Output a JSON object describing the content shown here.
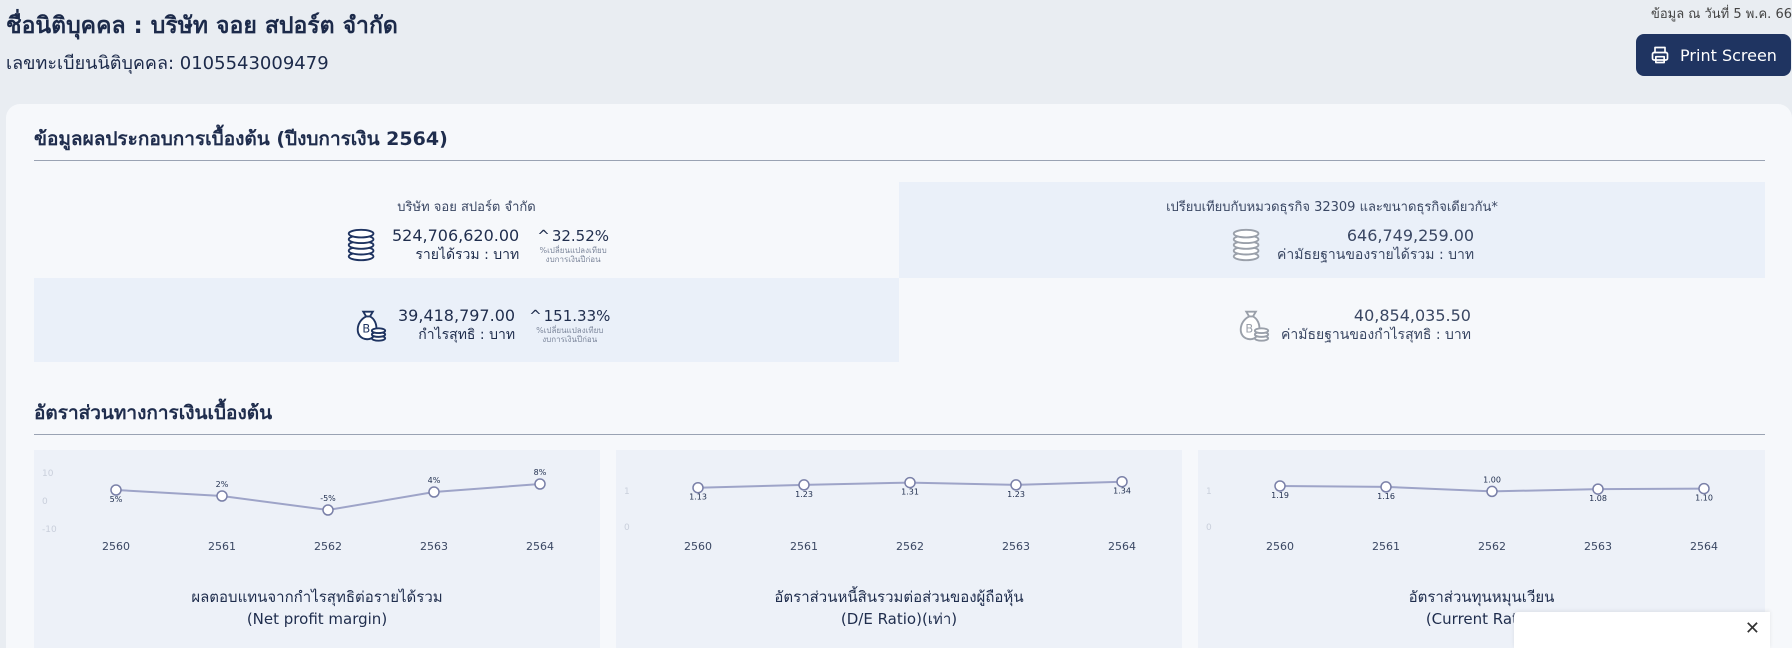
{
  "header": {
    "company_name": "ชื่อนิติบุคคล : บริษัท จอย สปอร์ต จำกัด",
    "registration": "เลขทะเบียนนิติบุคคล: 0105543009479",
    "as_of": "ข้อมูล ณ วันที่ 5 พ.ค. 66",
    "print_label": "Print Screen"
  },
  "performance": {
    "title": "ข้อมูลผลประกอบการเบื้องต้น (ปีงบการเงิน 2564)",
    "company_caption": "บริษัท จอย สปอร์ต จำกัด",
    "compare_caption": "เปรียบเทียบกับหมวดธุรกิจ 32309 และขนาดธุรกิจเดียวกัน*",
    "revenue": {
      "value": "524,706,620.00",
      "unit": "รายได้รวม : บาท",
      "change": "32.52%",
      "note_line1": "%เปลี่ยนแปลงเทียบ",
      "note_line2": "งบการเงินปีก่อน"
    },
    "net_profit": {
      "value": "39,418,797.00",
      "unit": "กำไรสุทธิ : บาท",
      "change": "151.33%",
      "note_line1": "%เปลี่ยนแปลงเทียบ",
      "note_line2": "งบการเงินปีก่อน"
    },
    "median_revenue": {
      "value": "646,749,259.00",
      "unit": "ค่ามัธยฐานของรายได้รวม : บาท"
    },
    "median_profit": {
      "value": "40,854,035.50",
      "unit": "ค่ามัธยฐานของกำไรสุทธิ : บาท"
    }
  },
  "ratios": {
    "title": "อัตราส่วนทางการเงินเบื้องต้น",
    "charts": [
      {
        "title1": "ผลตอบแทนจากกำไรสุทธิต่อรายได้รวม",
        "title2": "(Net profit margin)"
      },
      {
        "title1": "อัตราส่วนหนี้สินรวมต่อส่วนของผู้ถือหุ้น",
        "title2": "(D/E Ratio)(เท่า)"
      },
      {
        "title1": "อัตราส่วนทุนหมุนเวียน",
        "title2": "(Current Ratio)"
      }
    ]
  },
  "chart_data": [
    {
      "type": "line",
      "title": "ผลตอบแทนจากกำไรสุทธิต่อรายได้รวม (Net profit margin)",
      "x": [
        "2560",
        "2561",
        "2562",
        "2563",
        "2564"
      ],
      "values": [
        5,
        2,
        -5,
        4,
        8
      ],
      "data_labels": [
        "5%",
        "2%",
        "-5%",
        "4%",
        "8%"
      ],
      "y_ticks": [
        "10",
        "0",
        "-10"
      ],
      "ylim": [
        -10,
        10
      ]
    },
    {
      "type": "line",
      "title": "อัตราส่วนหนี้สินรวมต่อส่วนของผู้ถือหุ้น (D/E Ratio)(เท่า)",
      "x": [
        "2560",
        "2561",
        "2562",
        "2563",
        "2564"
      ],
      "values": [
        1.13,
        1.23,
        1.31,
        1.23,
        1.34
      ],
      "data_labels": [
        "1.13",
        "1.23",
        "1.31",
        "1.23",
        "1.34"
      ],
      "y_ticks": [
        "1",
        "0"
      ],
      "ylim": [
        0,
        1.4
      ]
    },
    {
      "type": "line",
      "title": "อัตราส่วนทุนหมุนเวียน (Current Ratio)",
      "x": [
        "2560",
        "2561",
        "2562",
        "2563",
        "2564"
      ],
      "values": [
        1.19,
        1.16,
        1.0,
        1.08,
        1.1
      ],
      "data_labels": [
        "1.19",
        "1.16",
        "1.00",
        "1.08",
        "1.10"
      ],
      "y_ticks": [
        "1",
        "0"
      ],
      "ylim": [
        0,
        1.4
      ]
    }
  ],
  "colors": {
    "navy": "#1f3461",
    "line": "#9ea4c8",
    "tile_blue": "#eaf0f9"
  }
}
